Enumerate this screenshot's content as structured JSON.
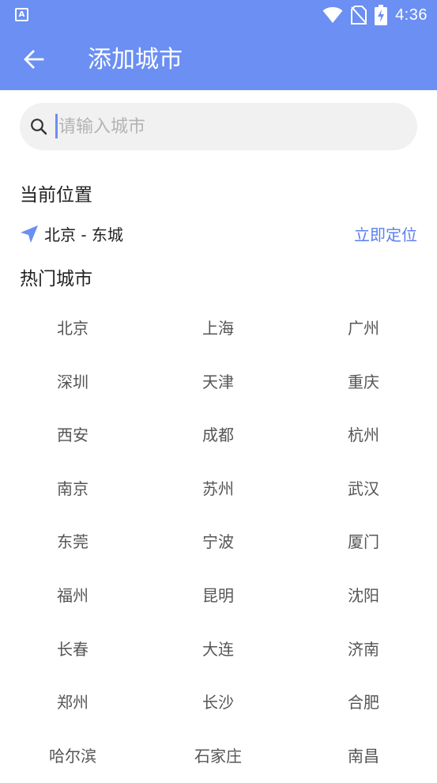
{
  "status_bar": {
    "app_icon_letter": "A",
    "time": "4:36"
  },
  "toolbar": {
    "title": "添加城市"
  },
  "search": {
    "placeholder": "请输入城市",
    "value": ""
  },
  "current_location": {
    "section_title": "当前位置",
    "city": "北京 - 东城",
    "locate_label": "立即定位"
  },
  "hot_cities": {
    "section_title": "热门城市",
    "cities": [
      "北京",
      "上海",
      "广州",
      "深圳",
      "天津",
      "重庆",
      "西安",
      "成都",
      "杭州",
      "南京",
      "苏州",
      "武汉",
      "东莞",
      "宁波",
      "厦门",
      "福州",
      "昆明",
      "沈阳",
      "长春",
      "大连",
      "济南",
      "郑州",
      "长沙",
      "合肥",
      "哈尔滨",
      "石家庄",
      "南昌"
    ]
  },
  "colors": {
    "accent": "#6b8ff2",
    "link": "#5a7ff0"
  }
}
